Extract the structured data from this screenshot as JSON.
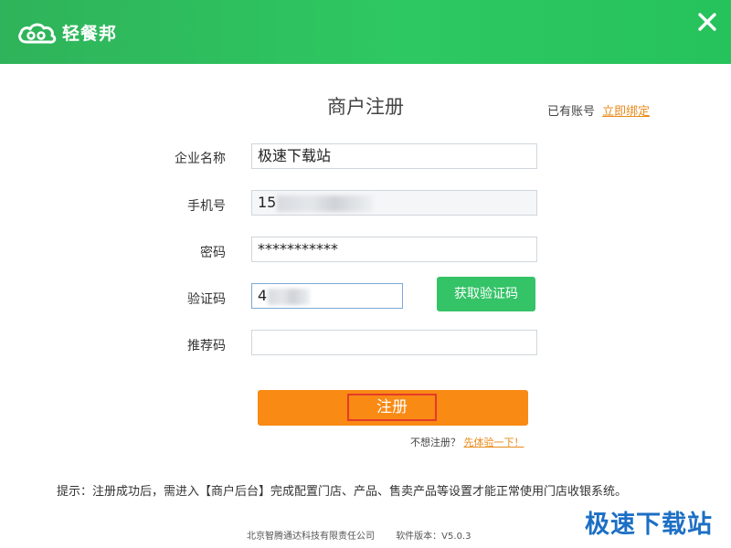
{
  "header": {
    "brand": "轻餐邦",
    "icons": {
      "logo": "cloud-logo-icon",
      "close": "close-icon"
    },
    "color": "#2ec862"
  },
  "title": "商户注册",
  "account": {
    "prompt": "已有账号",
    "bind_link": "立即绑定"
  },
  "form": {
    "company": {
      "label": "企业名称",
      "value": "极速下载站"
    },
    "phone": {
      "label": "手机号",
      "value": "15"
    },
    "password": {
      "label": "密码",
      "value": "***********"
    },
    "captcha": {
      "label": "验证码",
      "value": "4",
      "button": "获取验证码"
    },
    "referral": {
      "label": "推荐码",
      "value": ""
    }
  },
  "register_button": "注册",
  "trial": {
    "prompt": "不想注册？",
    "link": "先体验一下！"
  },
  "tip": "提示：注册成功后，需进入【商户后台】完成配置门店、产品、售卖产品等设置才能正常使用门店收银系统。",
  "footer": {
    "company": "北京智腾通达科技有限责任公司",
    "version": "软件版本：V5.0.3"
  },
  "watermark": "极速下载站",
  "colors": {
    "accent_green": "#35c368",
    "register_orange": "#f98a14",
    "link_orange": "#e88a1a",
    "watermark_blue": "#1c6fc4"
  }
}
